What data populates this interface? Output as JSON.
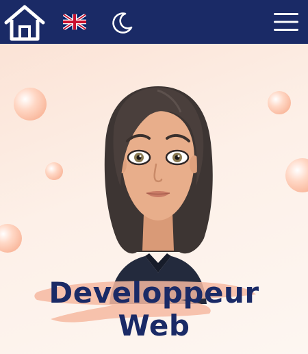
{
  "nav": {
    "home_icon": "home-icon",
    "language_icon": "uk-flag-icon",
    "theme_icon": "moon-icon",
    "menu_icon": "hamburger-menu-icon",
    "background_color": "#1a2a66"
  },
  "hero": {
    "title_line1": "Developpeur",
    "title_line2": "Web",
    "title_color": "#1a2a66",
    "accent_color": "#f6a584"
  }
}
